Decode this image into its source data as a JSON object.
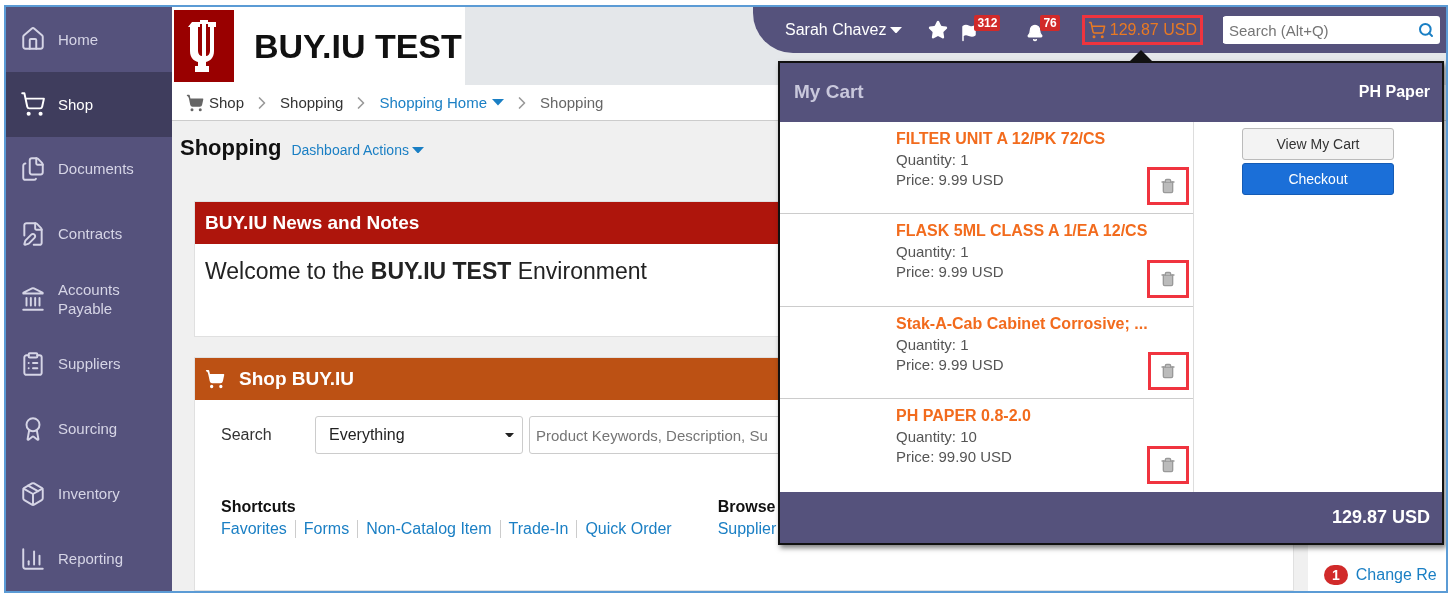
{
  "sidebar": {
    "items": [
      {
        "label": "Home",
        "selected": false
      },
      {
        "label": "Shop",
        "selected": true
      },
      {
        "label": "Documents",
        "selected": false
      },
      {
        "label": "Contracts",
        "selected": false
      },
      {
        "label": "Accounts Payable",
        "selected": false
      },
      {
        "label": "Suppliers",
        "selected": false
      },
      {
        "label": "Sourcing",
        "selected": false
      },
      {
        "label": "Inventory",
        "selected": false
      },
      {
        "label": "Reporting",
        "selected": false
      }
    ]
  },
  "logo": {
    "title": "BUY.IU TEST"
  },
  "top_bar": {
    "user": "Sarah Chavez",
    "flag_badge": "312",
    "bell_badge": "76",
    "cart_total": "129.87 USD",
    "cart_highlighted": true,
    "search": {
      "placeholder": "Search (Alt+Q)"
    }
  },
  "breadcrumb": [
    {
      "label": "Shop",
      "kind": "root"
    },
    {
      "label": "Shopping",
      "kind": "plain"
    },
    {
      "label": "Shopping Home",
      "kind": "link"
    },
    {
      "label": "Shopping",
      "kind": "current"
    }
  ],
  "page_title": "Shopping",
  "page_actions": "Dashboard Actions",
  "news": {
    "title": "BUY.IU News and Notes",
    "text": "Welcome to the **BUY.IU TEST** Environment"
  },
  "shop": {
    "title": "Shop BUY.IU",
    "search_label": "Search",
    "scope": "Everything",
    "keywords": {
      "placeholder": "Product Keywords, Description, Su"
    },
    "shortcuts_title": "Shortcuts",
    "shortcuts": [
      "Favorites",
      "Forms",
      "Non-Catalog Item",
      "Trade-In",
      "Quick Order"
    ],
    "browse_title": "Browse",
    "browse_links": [
      "Supplier"
    ]
  },
  "side_list": [
    {
      "badge": "1",
      "label": "Change Re"
    }
  ],
  "cart": {
    "title": "My Cart",
    "cart_name": "PH Paper",
    "view_button": "View My Cart",
    "checkout_button": "Checkout",
    "total": "129.87 USD",
    "items": [
      {
        "name": "FILTER UNIT A 12/PK 72/CS",
        "quantity": "Quantity: 1",
        "price": "Price: 9.99 USD",
        "highlighted": true
      },
      {
        "name": "FLASK 5ML CLASS A 1/EA 12/CS",
        "quantity": "Quantity: 1",
        "price": "Price: 9.99 USD",
        "highlighted": true
      },
      {
        "name": "Stak-A-Cab Cabinet Corrosive; ...",
        "quantity": "Quantity: 1",
        "price": "Price: 9.99 USD",
        "highlighted": true
      },
      {
        "name": "PH PAPER 0.8-2.0",
        "quantity": "Quantity: 10",
        "price": "Price: 99.90 USD",
        "highlighted": true
      }
    ]
  }
}
